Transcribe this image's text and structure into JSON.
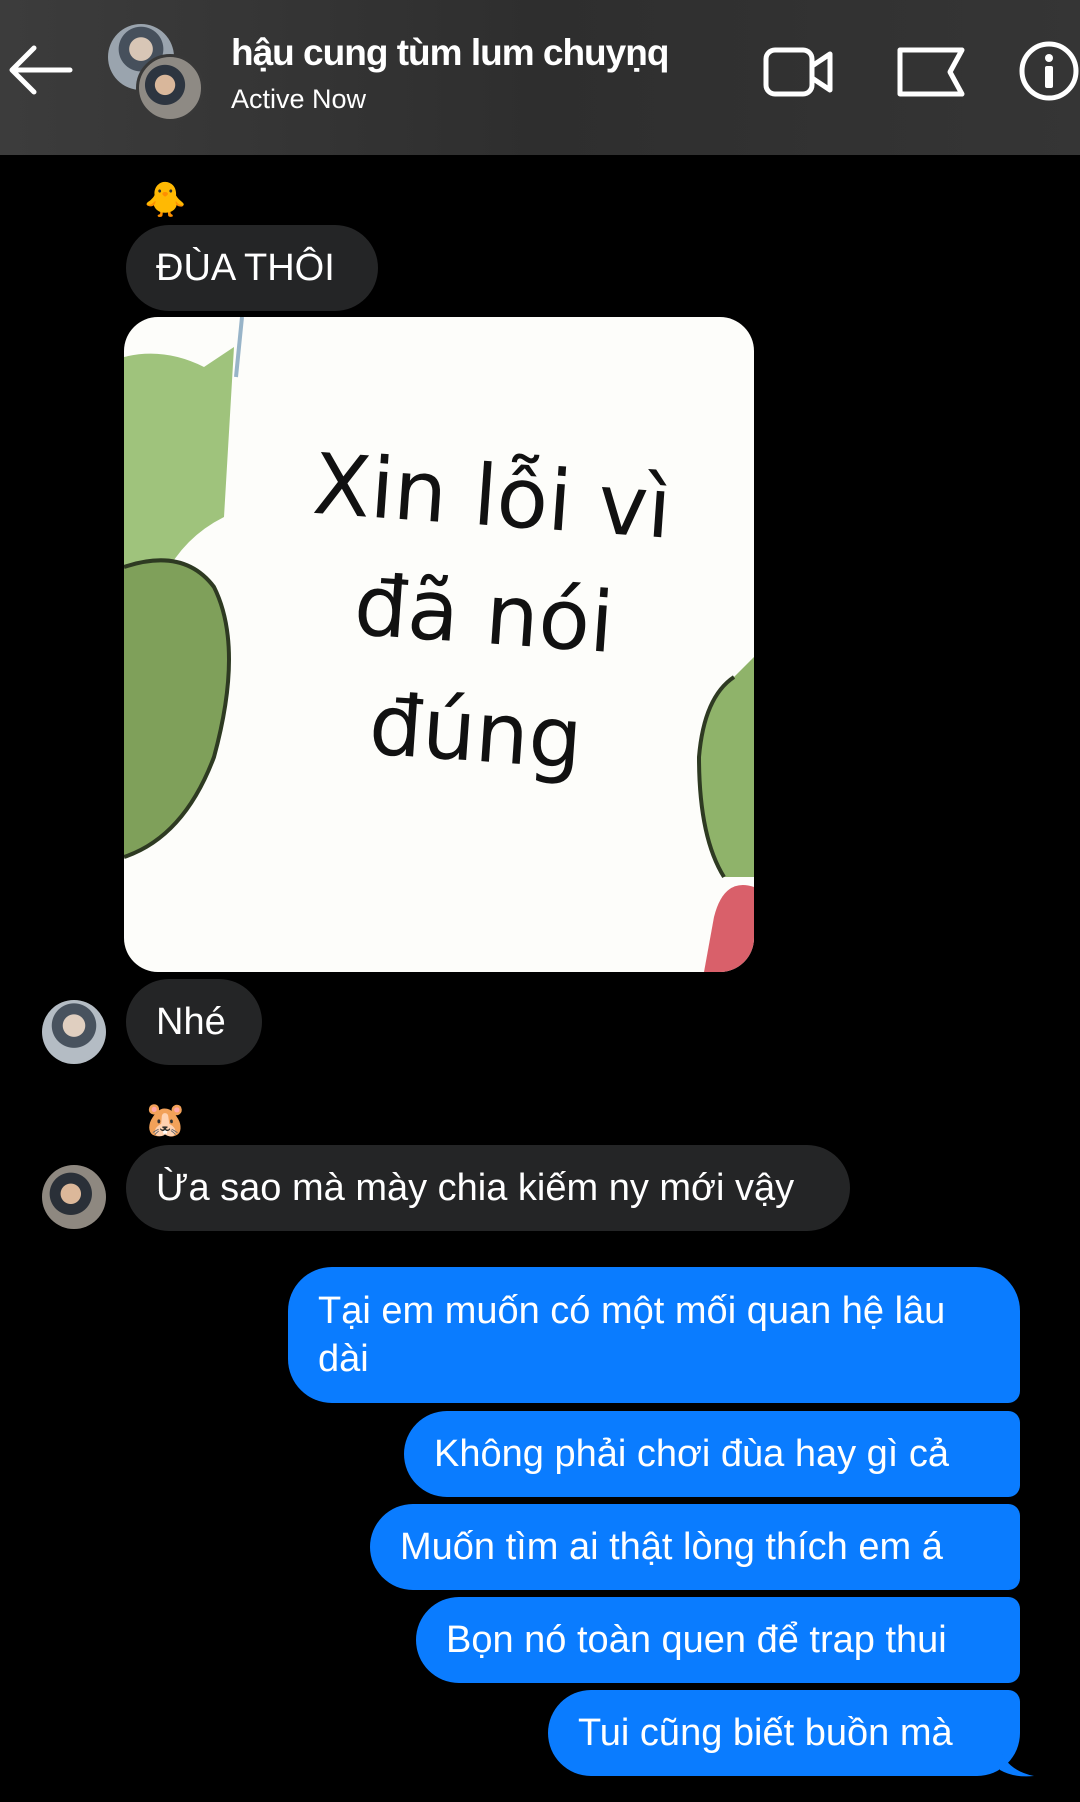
{
  "header": {
    "title": "hậu cung tùm lum chuyṇq",
    "status": "Active Now"
  },
  "messages": {
    "reaction_1": "🐥",
    "msg_1": "ĐÙA THÔI",
    "meme_text": "Xin lỗi vì đã nói đúng",
    "msg_2": "Nhé",
    "reaction_2": "🐹",
    "msg_3": "Ừa sao mà mày chia kiếm ny mới vậy",
    "sent_1": "Tại em muốn có một mối quan hệ lâu dài",
    "sent_2": "Không phải chơi đùa hay gì cả",
    "sent_3": "Muốn tìm ai thật lòng thích em á",
    "sent_4": "Bọn nó toàn quen để trap thui",
    "sent_5": "Tui cũng biết buồn mà"
  },
  "colors": {
    "sent_bubble": "#0a7cff",
    "received_bubble": "#242526",
    "background": "#000000",
    "header": "#353535"
  },
  "icons": [
    "back-arrow-icon",
    "video-call-icon",
    "flag-icon",
    "info-icon"
  ]
}
